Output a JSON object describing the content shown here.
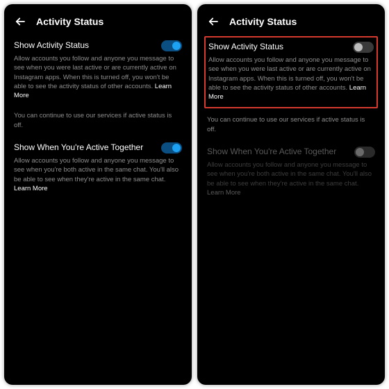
{
  "header": {
    "title": "Activity Status"
  },
  "settings": {
    "showActivity": {
      "title": "Show Activity Status",
      "desc": "Allow accounts you follow and anyone you message to see when you were last active or are currently active on Instagram apps. When this is turned off, you won't be able to see the activity status of other accounts.",
      "learnMore": "Learn More"
    },
    "continueNote": "You can continue to use our services if active status is off.",
    "activeTogether": {
      "title": "Show When You're Active Together",
      "desc": "Allow accounts you follow and anyone you message to see when you're both active in the same chat. You'll also be able to see when they're active in the same chat.",
      "learnMore": "Learn More"
    }
  },
  "left": {
    "showActivityOn": true,
    "activeTogetherOn": true
  },
  "right": {
    "showActivityOn": false,
    "activeTogetherOn": false,
    "activeTogetherDisabled": true
  }
}
